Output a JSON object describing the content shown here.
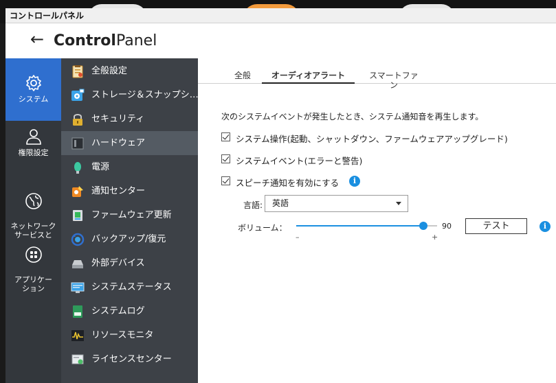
{
  "window": {
    "title": "コントロールパネル"
  },
  "header": {
    "back": "←",
    "title_bold": "Control",
    "title_rest": "Panel"
  },
  "rail": [
    {
      "label": "システム",
      "icon": "gear-icon",
      "active": true
    },
    {
      "label": "権限設定",
      "icon": "user-icon",
      "active": false
    },
    {
      "label": "ネットワーク\nサービスと",
      "icon": "globe-icon",
      "active": false
    },
    {
      "label": "アプリケー\nション",
      "icon": "apps-grid-icon",
      "active": false
    }
  ],
  "menu": [
    {
      "label": "全般設定",
      "icon": "clipboard-icon",
      "color": "#d9a441"
    },
    {
      "label": "ストレージ＆スナップシ…",
      "icon": "storage-icon",
      "color": "#3ba3e8"
    },
    {
      "label": "セキュリティ",
      "icon": "lock-icon",
      "color": "#e0b030"
    },
    {
      "label": "ハードウェア",
      "icon": "hardware-icon",
      "color": "#555b62",
      "active": true
    },
    {
      "label": "電源",
      "icon": "power-icon",
      "color": "#3cc8a0"
    },
    {
      "label": "通知センター",
      "icon": "notification-icon",
      "color": "#f08a24"
    },
    {
      "label": "ファームウェア更新",
      "icon": "firmware-icon",
      "color": "#35b85a"
    },
    {
      "label": "バックアップ/復元",
      "icon": "backup-icon",
      "color": "#2f6fcf"
    },
    {
      "label": "外部デバイス",
      "icon": "external-device-icon",
      "color": "#9aa0a6"
    },
    {
      "label": "システムステータス",
      "icon": "monitor-icon",
      "color": "#3ba3e8"
    },
    {
      "label": "システムログ",
      "icon": "log-icon",
      "color": "#2e9a5a"
    },
    {
      "label": "リソースモニタ",
      "icon": "resource-monitor-icon",
      "color": "#e8c230"
    },
    {
      "label": "ライセンスセンター",
      "icon": "license-icon",
      "color": "#4fbf6a"
    }
  ],
  "tabs": [
    {
      "label": "全般",
      "active": false
    },
    {
      "label": "オーディオアラート",
      "active": true
    },
    {
      "label": "スマートファン",
      "active": false
    }
  ],
  "audio": {
    "description": "次のシステムイベントが発生したとき、システム通知音を再生します。",
    "options": [
      {
        "label": "システム操作(起動、シャットダウン、ファームウェアアップグレード)",
        "checked": true
      },
      {
        "label": "システムイベント(エラーと警告)",
        "checked": true
      },
      {
        "label": "スピーチ通知を有効にする",
        "checked": true,
        "info": "i"
      }
    ],
    "language_label": "言語:",
    "language_value": "英語",
    "volume_label": "ボリューム：",
    "volume_value": "90",
    "volume_level": 90,
    "volume_min": "–",
    "volume_max": "+",
    "test_label": "テスト",
    "info": "i"
  },
  "colors": {
    "accent": "#1a8fe0",
    "rail_active": "#2f6fcf",
    "rail_bg": "#33373c",
    "menu_bg": "#3d4147"
  }
}
